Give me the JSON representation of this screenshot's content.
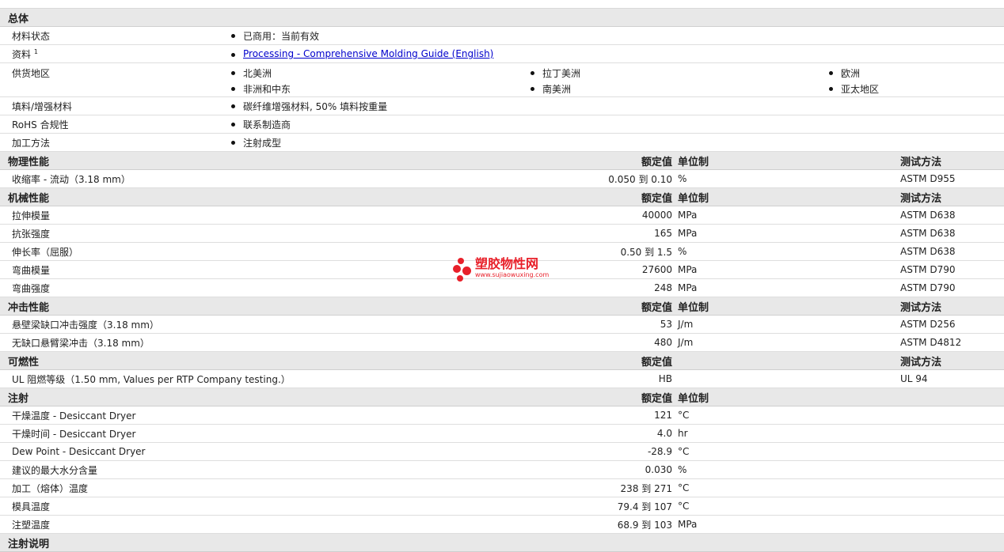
{
  "general": {
    "title": "总体",
    "rows": [
      {
        "label": "材料状态",
        "value": "已商用：当前有效"
      },
      {
        "label": "资料",
        "sup": "1",
        "link": "Processing - Comprehensive Molding Guide (English)"
      },
      {
        "label": "供货地区",
        "regions": [
          "北美洲",
          "拉丁美洲",
          "欧洲",
          "非洲和中东",
          "南美洲",
          "亚太地区"
        ]
      },
      {
        "label": "填料/增强材料",
        "value": "碳纤维增强材料, 50% 填料按重量"
      },
      {
        "label": "RoHS 合规性",
        "value": "联系制造商"
      },
      {
        "label": "加工方法",
        "value": "注射成型"
      }
    ]
  },
  "headers": {
    "nominal": "额定值",
    "unit": "单位制",
    "test": "测试方法"
  },
  "physical": {
    "title": "物理性能",
    "rows": [
      {
        "label": "收缩率 - 流动（3.18 mm）",
        "value": "0.050 到  0.10",
        "unit": "%",
        "test": "ASTM D955"
      }
    ]
  },
  "mechanical": {
    "title": "机械性能",
    "rows": [
      {
        "label": "拉伸模量",
        "value": "40000",
        "unit": "MPa",
        "test": "ASTM D638"
      },
      {
        "label": "抗张强度",
        "value": "165",
        "unit": "MPa",
        "test": "ASTM D638"
      },
      {
        "label": "伸长率（屈服）",
        "value": "0.50 到  1.5",
        "unit": "%",
        "test": "ASTM D638"
      },
      {
        "label": "弯曲模量",
        "value": "27600",
        "unit": "MPa",
        "test": "ASTM D790"
      },
      {
        "label": "弯曲强度",
        "value": "248",
        "unit": "MPa",
        "test": "ASTM D790"
      }
    ]
  },
  "impact": {
    "title": "冲击性能",
    "rows": [
      {
        "label": "悬壁梁缺口冲击强度（3.18 mm）",
        "value": "53",
        "unit": "J/m",
        "test": "ASTM D256"
      },
      {
        "label": "无缺口悬臂梁冲击（3.18 mm）",
        "value": "480",
        "unit": "J/m",
        "test": "ASTM D4812"
      }
    ]
  },
  "flammability": {
    "title": "可燃性",
    "rows": [
      {
        "label": "UL 阻燃等级（1.50 mm, Values per RTP Company testing.）",
        "value": "HB",
        "unit": "",
        "test": "UL 94"
      }
    ]
  },
  "injection": {
    "title": "注射",
    "rows": [
      {
        "label": "干燥温度 - Desiccant Dryer",
        "value": "121",
        "unit": "°C"
      },
      {
        "label": "干燥时间 - Desiccant Dryer",
        "value": "4.0",
        "unit": "hr"
      },
      {
        "label": "Dew Point - Desiccant Dryer",
        "value": "-28.9",
        "unit": "°C"
      },
      {
        "label": "建议的最大水分含量",
        "value": "0.030",
        "unit": "%"
      },
      {
        "label": "加工（熔体）温度",
        "value": "238 到  271",
        "unit": "°C"
      },
      {
        "label": "模具温度",
        "value": "79.4 到  107",
        "unit": "°C"
      },
      {
        "label": "注塑温度",
        "value": "68.9 到  103",
        "unit": "MPa"
      }
    ]
  },
  "injection_notes": {
    "title": "注射说明"
  },
  "watermark": {
    "cn": "塑胶物性网",
    "en": "www.sujiaowuxing.com",
    "color": "#e8202a"
  },
  "colors": {
    "header_bg": "#e8e8e8",
    "link": "#0000cc"
  }
}
